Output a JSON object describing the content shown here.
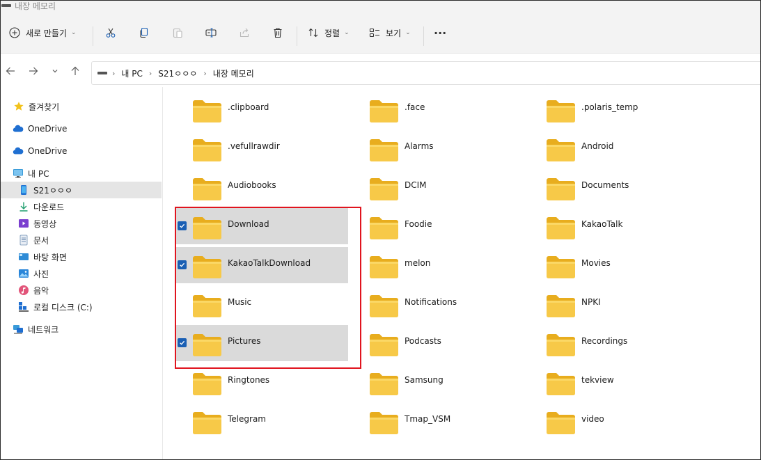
{
  "window": {
    "title": "내장 메모리"
  },
  "toolbar": {
    "new_label": "새로 만들기",
    "sort_label": "정렬",
    "view_label": "보기",
    "more_label": "···"
  },
  "address": {
    "crumbs": [
      "내 PC",
      "S21ㅇㅇㅇ",
      "내장 메모리"
    ]
  },
  "sidebar": {
    "items": [
      {
        "label": "즐겨찾기",
        "icon": "star-icon"
      },
      {
        "label": "OneDrive",
        "icon": "cloud-icon"
      },
      {
        "label": "OneDrive",
        "icon": "cloud-icon"
      },
      {
        "label": "내 PC",
        "icon": "monitor-icon"
      },
      {
        "label": "S21ㅇㅇㅇ",
        "icon": "phone-icon",
        "selected": true
      },
      {
        "label": "다운로드",
        "icon": "download-icon"
      },
      {
        "label": "동영상",
        "icon": "video-icon"
      },
      {
        "label": "문서",
        "icon": "document-icon"
      },
      {
        "label": "바탕 화면",
        "icon": "desktop-icon"
      },
      {
        "label": "사진",
        "icon": "picture-icon"
      },
      {
        "label": "음악",
        "icon": "music-icon"
      },
      {
        "label": "로컬 디스크 (C:)",
        "icon": "disk-icon"
      },
      {
        "label": "네트워크",
        "icon": "network-icon"
      }
    ]
  },
  "folders": {
    "items": [
      {
        "name": ".clipboard"
      },
      {
        "name": ".face"
      },
      {
        "name": ".polaris_temp"
      },
      {
        "name": ".vefullrawdir"
      },
      {
        "name": "Alarms"
      },
      {
        "name": "Android"
      },
      {
        "name": "Audiobooks"
      },
      {
        "name": "DCIM"
      },
      {
        "name": "Documents"
      },
      {
        "name": "Download",
        "selected": true
      },
      {
        "name": "Foodie"
      },
      {
        "name": "KakaoTalk"
      },
      {
        "name": "KakaoTalkDownload",
        "selected": true
      },
      {
        "name": "melon"
      },
      {
        "name": "Movies"
      },
      {
        "name": "Music"
      },
      {
        "name": "Notifications"
      },
      {
        "name": "NPKI"
      },
      {
        "name": "Pictures",
        "selected": true
      },
      {
        "name": "Podcasts"
      },
      {
        "name": "Recordings"
      },
      {
        "name": "Ringtones"
      },
      {
        "name": "Samsung"
      },
      {
        "name": "tekview"
      },
      {
        "name": "Telegram"
      },
      {
        "name": "Tmap_VSM"
      },
      {
        "name": "video"
      }
    ]
  },
  "colors": {
    "folder": "#f5c542",
    "selection": "#dadada",
    "highlight_border": "#e0141e",
    "checkbox": "#1a5fb4"
  }
}
